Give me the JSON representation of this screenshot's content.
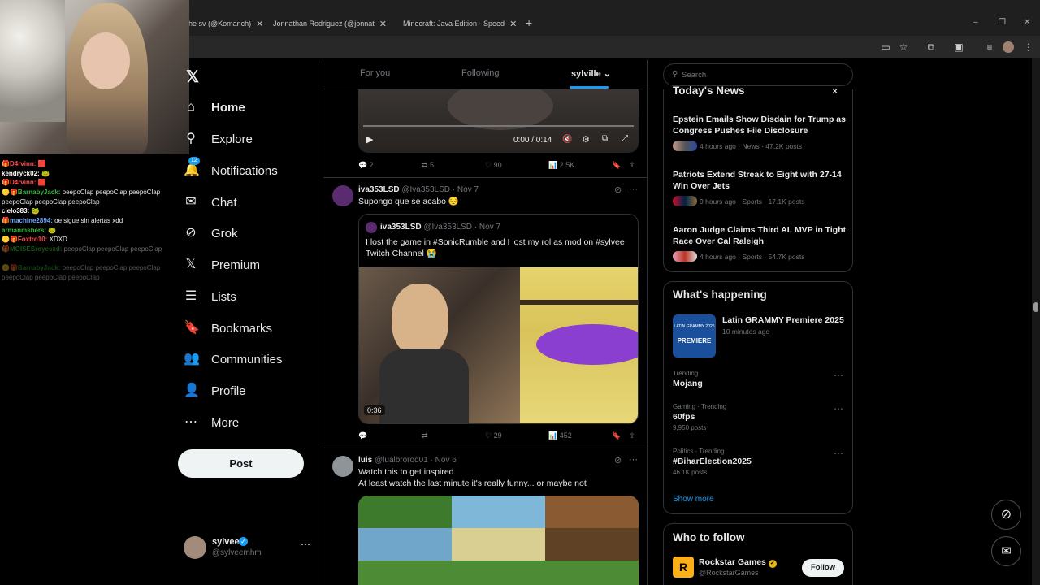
{
  "browser": {
    "tabs": [
      {
        "label": "he sv (@Komanch)",
        "favicon_color": "#1d1d1d"
      },
      {
        "label": "Jonnathan Rodriguez (@jonnat",
        "favicon_color": "#e1306c"
      },
      {
        "label": "Minecraft: Java Edition - Speed",
        "favicon_color": "#6b4a2b"
      }
    ],
    "new_tab": "+",
    "window_controls": [
      "–",
      "❐",
      "✕"
    ]
  },
  "chat": [
    {
      "user": "D4rvinn:",
      "msg": "",
      "color": "#ff4d4d"
    },
    {
      "user": "kendryck02:",
      "msg": "",
      "color": "#ffffff"
    },
    {
      "user": "D4rvinn:",
      "msg": "",
      "color": "#ff4d4d"
    },
    {
      "user": "BarnabyJack:",
      "msg": "peepoClap   peepoClap   peepoClap   peepoClap   peepoClap   peepoClap",
      "color": "#3ab53a"
    },
    {
      "user": "cielo383:",
      "msg": "",
      "color": "#ffffff"
    },
    {
      "user": "machine2894:",
      "msg": "oe sigue sin alertas xdd",
      "color": "#6fa8ff"
    },
    {
      "user": "armanmshers:",
      "msg": "",
      "color": "#3ab53a"
    },
    {
      "user": "Foxtro10:",
      "msg": "XDXD",
      "color": "#ff4d4d"
    },
    {
      "user": "MOISESroyesxd:",
      "msg": "peepoClap   peepoClap   peepoClap",
      "color": "#3ab53a"
    },
    {
      "user": "BarnabyJack:",
      "msg": "peepoClap   peepoClap   peepoClap   peepoClap   peepoClap   peepoClap",
      "color": "#3ab53a"
    }
  ],
  "nav": {
    "items": [
      {
        "label": "Home",
        "icon": "home-icon",
        "glyph": "⌂"
      },
      {
        "label": "Explore",
        "icon": "search-icon",
        "glyph": "⚲"
      },
      {
        "label": "Notifications",
        "icon": "bell-icon",
        "glyph": "🔔",
        "badge": "12"
      },
      {
        "label": "Chat",
        "icon": "mail-icon",
        "glyph": "✉"
      },
      {
        "label": "Grok",
        "icon": "grok-icon",
        "glyph": "⊘"
      },
      {
        "label": "Premium",
        "icon": "x-logo-icon",
        "glyph": "𝕏"
      },
      {
        "label": "Lists",
        "icon": "lists-icon",
        "glyph": "☰"
      },
      {
        "label": "Bookmarks",
        "icon": "bookmark-icon",
        "glyph": "🔖"
      },
      {
        "label": "Communities",
        "icon": "communities-icon",
        "glyph": "👥"
      },
      {
        "label": "Profile",
        "icon": "profile-icon",
        "glyph": "👤"
      },
      {
        "label": "More",
        "icon": "more-icon",
        "glyph": "⋯"
      }
    ],
    "post_label": "Post",
    "account": {
      "name": "sylvee",
      "handle": "@sylveemhm"
    }
  },
  "timeline": {
    "tabs": [
      "For you",
      "Following",
      "sylville"
    ],
    "video_top": {
      "time": "0:00 / 0:14"
    },
    "post0_actions": {
      "replies": "2",
      "reposts": "5",
      "likes": "90",
      "views": "2.5K"
    },
    "post1": {
      "name": "iva353LSD",
      "handle": "@Iva353LSD",
      "date": "· Nov 7",
      "text": "Supongo que se acabo 😔",
      "quote": {
        "name": "iva353LSD",
        "handle": "@Iva353LSD",
        "date": "· Nov 7",
        "text": "I lost the game in #SonicRumble and I lost my rol as mod on #sylvee Twitch Channel 😭",
        "duration": "0:36"
      },
      "actions": {
        "replies": "",
        "reposts": "",
        "likes": "29",
        "views": "452"
      }
    },
    "post2": {
      "name": "luis",
      "handle": "@lualbrorod01",
      "date": "· Nov 6",
      "line1": "Watch this to get inspired",
      "line2": "At least watch the last minute it's really funny... or maybe not"
    }
  },
  "right": {
    "search_placeholder": "Search",
    "news_title": "Today's News",
    "news": [
      {
        "headline": "Epstein Emails Show Disdain for Trump as Congress Pushes File Disclosure",
        "meta": "4 hours ago · News · 47.2K posts"
      },
      {
        "headline": "Patriots Extend Streak to Eight with 27-14 Win Over Jets",
        "meta": "9 hours ago · Sports · 17.1K posts"
      },
      {
        "headline": "Aaron Judge Claims Third AL MVP in Tight Race Over Cal Raleigh",
        "meta": "4 hours ago · Sports · 54.7K posts"
      }
    ],
    "happening_title": "What's happening",
    "event": {
      "title": "Latin GRAMMY Premiere 2025",
      "time": "10 minutes ago",
      "thumb_text": "PREMIERE",
      "thumb_sub": "LATIN GRAMMY 2025"
    },
    "trends": [
      {
        "context": "Trending",
        "name": "Mojang",
        "posts": ""
      },
      {
        "context": "Gaming · Trending",
        "name": "60fps",
        "posts": "9,950 posts"
      },
      {
        "context": "Politics · Trending",
        "name": "#BiharElection2025",
        "posts": "46.1K posts"
      }
    ],
    "show_more": "Show more",
    "who_title": "Who to follow",
    "follow": {
      "name": "Rockstar Games",
      "handle": "@RockstarGames",
      "button": "Follow"
    }
  },
  "colors": {
    "accent": "#1d9bf0",
    "verified": "#1d9bf0",
    "gold": "#e2b719"
  }
}
